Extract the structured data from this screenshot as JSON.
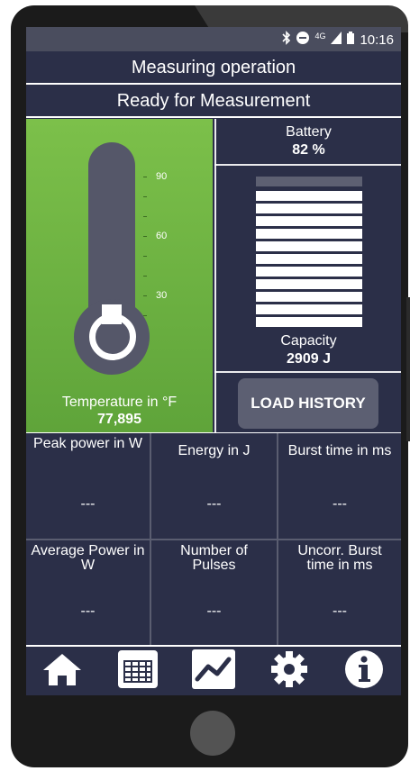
{
  "status_bar": {
    "time": "10:16",
    "network": "4G"
  },
  "header": {
    "title": "Measuring operation",
    "subtitle": "Ready for Measurement"
  },
  "thermometer": {
    "label": "Temperature in °F",
    "value": "77,895",
    "ticks": [
      "90",
      "60",
      "30"
    ]
  },
  "battery": {
    "label": "Battery",
    "value": "82 %"
  },
  "capacity": {
    "label": "Capacity",
    "value": "2909 J",
    "bars_filled": 11,
    "bars_total": 12
  },
  "load_history_label": "LOAD HISTORY",
  "metrics": [
    {
      "title": "Peak power in W",
      "value": "---"
    },
    {
      "title": "Energy in J",
      "value": "---"
    },
    {
      "title": "Burst time in ms",
      "value": "---"
    },
    {
      "title": "Average Power in W",
      "value": "---"
    },
    {
      "title": "Number of Pulses",
      "value": "---"
    },
    {
      "title": "Uncorr. Burst time in ms",
      "value": "---"
    }
  ],
  "nav": [
    "home-icon",
    "table-icon",
    "chart-icon",
    "gear-icon",
    "info-icon"
  ],
  "colors": {
    "screen_bg": "#2b2f48",
    "thermo_bg": "#6db443",
    "button": "#5c5f72"
  }
}
